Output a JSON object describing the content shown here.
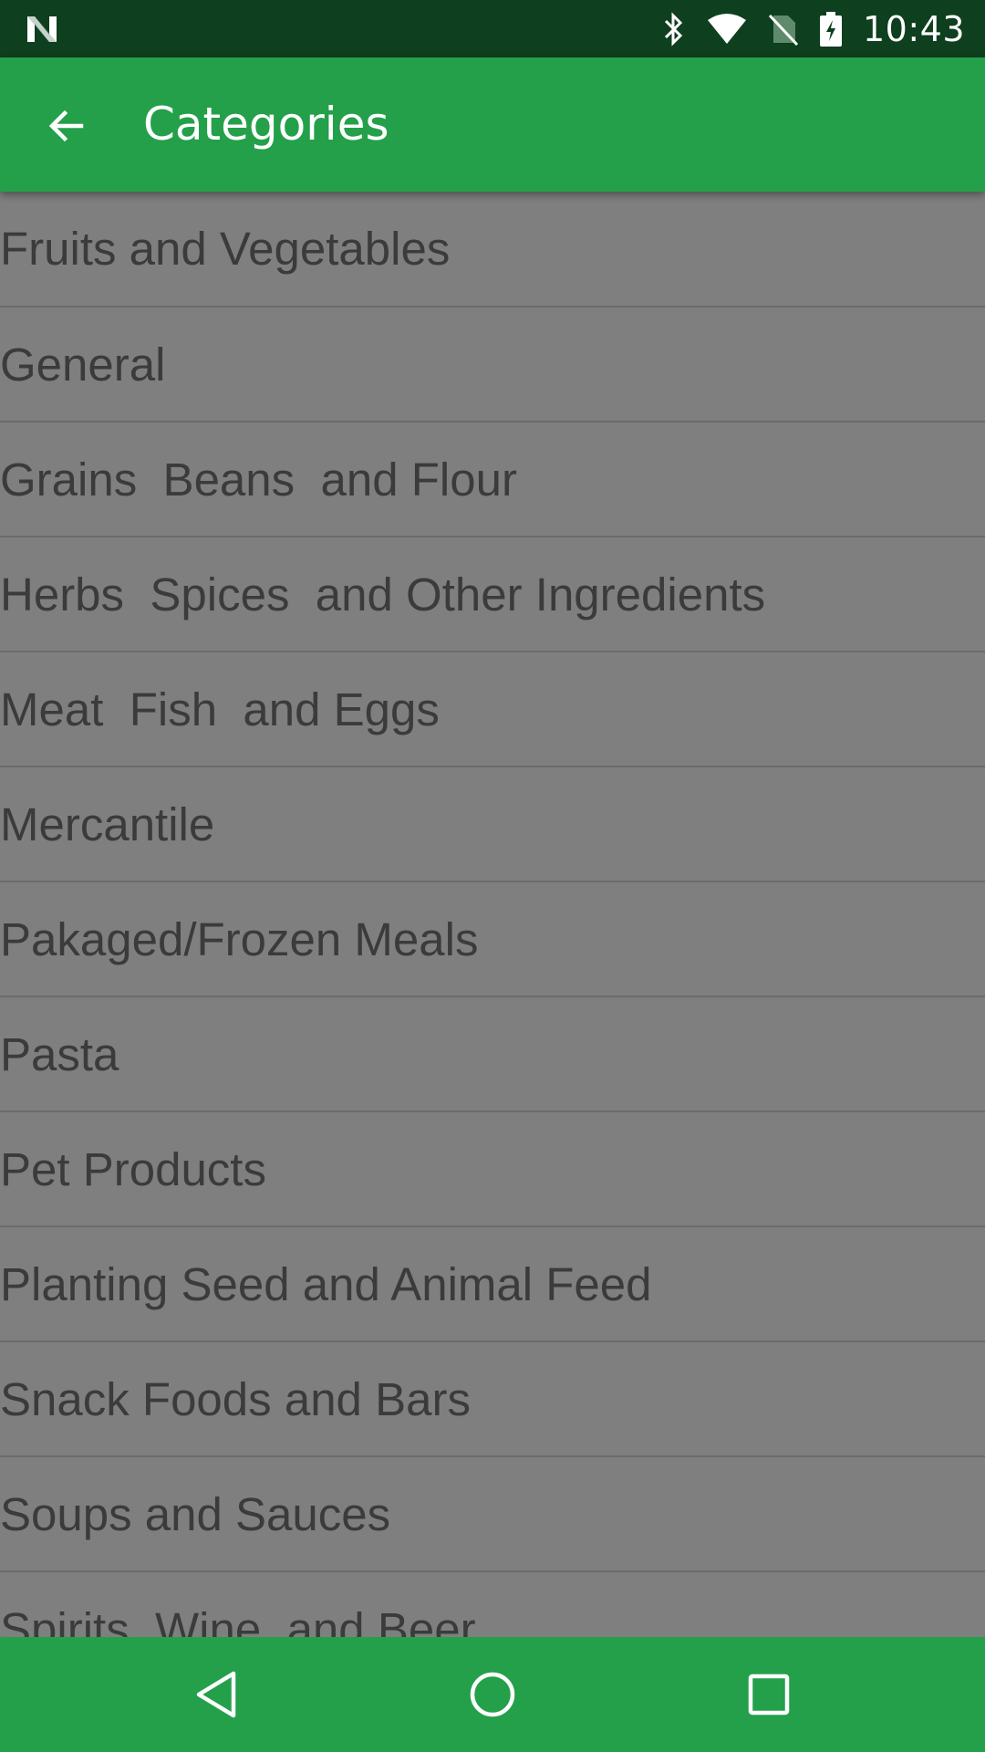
{
  "status_bar": {
    "time": "10:43",
    "icons": [
      "notification-n-icon",
      "bluetooth-icon",
      "wifi-icon",
      "no-sim-icon",
      "battery-charging-icon"
    ]
  },
  "app_bar": {
    "title": "Categories",
    "back_icon": "arrow-back-icon"
  },
  "categories": [
    "Fruits and Vegetables",
    "General",
    "Grains  Beans  and Flour",
    "Herbs  Spices  and Other Ingredients",
    "Meat  Fish  and Eggs",
    "Mercantile",
    "Pakaged/Frozen Meals",
    "Pasta",
    "Pet Products",
    "Planting Seed and Animal Feed",
    "Snack Foods and Bars",
    "Soups and Sauces",
    "Spirits  Wine  and Beer"
  ],
  "nav_bar": {
    "icons": [
      "nav-back-icon",
      "nav-home-icon",
      "nav-recents-icon"
    ]
  },
  "colors": {
    "status_bar": "#0e3f1e",
    "app_bar": "#24a04a",
    "list_background": "#7f7f7f",
    "item_text": "#3b3b3b",
    "divider": "#6b6b6b"
  }
}
